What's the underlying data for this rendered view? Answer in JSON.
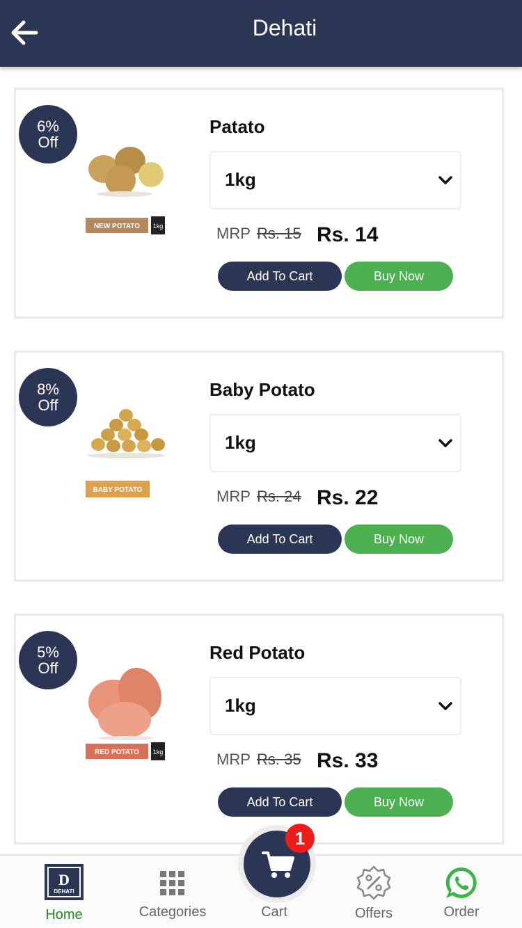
{
  "header": {
    "title": "Dehati"
  },
  "products": [
    {
      "discount_pct": "6%",
      "discount_off": "Off",
      "name": "Patato",
      "unit": "1kg",
      "mrp_label": "MRP",
      "mrp_old": "Rs. 15",
      "price": "Rs. 14",
      "tag_label": "NEW POTATO",
      "tag_unit": "1kg",
      "add_label": "Add To Cart",
      "buy_label": "Buy Now"
    },
    {
      "discount_pct": "8%",
      "discount_off": "Off",
      "name": "Baby Potato",
      "unit": "1kg",
      "mrp_label": "MRP",
      "mrp_old": "Rs. 24",
      "price": "Rs. 22",
      "tag_label": "BABY POTATO",
      "tag_unit": "",
      "add_label": "Add To Cart",
      "buy_label": "Buy Now"
    },
    {
      "discount_pct": "5%",
      "discount_off": "Off",
      "name": "Red Potato",
      "unit": "1kg",
      "mrp_label": "MRP",
      "mrp_old": "Rs. 35",
      "price": "Rs. 33",
      "tag_label": "RED POTATO",
      "tag_unit": "1kg",
      "add_label": "Add To Cart",
      "buy_label": "Buy Now"
    }
  ],
  "bottom_nav": {
    "home": "Home",
    "categories": "Categories",
    "cart": "Cart",
    "offers": "Offers",
    "order": "Order",
    "cart_count": "1",
    "logo_letter": "D",
    "logo_text": "DEHATI"
  },
  "colors": {
    "primary": "#2b3655",
    "accent_green": "#4caf50",
    "badge_red": "#ef1c1c",
    "active_nav": "#1e8a1e"
  }
}
